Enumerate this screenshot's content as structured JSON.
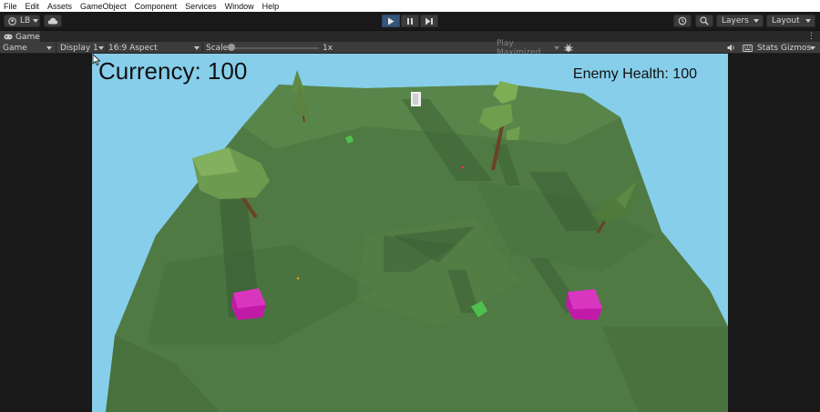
{
  "menu": {
    "items": [
      "File",
      "Edit",
      "Assets",
      "GameObject",
      "Component",
      "Services",
      "Window",
      "Help"
    ]
  },
  "toolbar": {
    "account_label": "LB",
    "layers_label": "Layers",
    "layout_label": "Layout",
    "icons": [
      "account-icon",
      "cloud-icon",
      "play-icon",
      "pause-icon",
      "step-icon",
      "history-icon",
      "search-icon"
    ]
  },
  "tab": {
    "label": "Game"
  },
  "game_bar": {
    "mode": "Game",
    "display": "Display 1",
    "aspect": "16:9 Aspect",
    "scale_label": "Scale",
    "scale_value_text": "1x",
    "scale_value": 1,
    "play_mode": "Play Maximized",
    "stats_label": "Stats",
    "gizmos_label": "Gizmos"
  },
  "hud": {
    "currency": "Currency: 100",
    "enemy_health": "Enemy Health: 100"
  },
  "colors": {
    "sky": "#87ceeb",
    "terrain": "#4f7a43",
    "magenta_cube": "#c21aa8",
    "green_cube": "#4fbf4f",
    "play_active": "#36557a"
  }
}
